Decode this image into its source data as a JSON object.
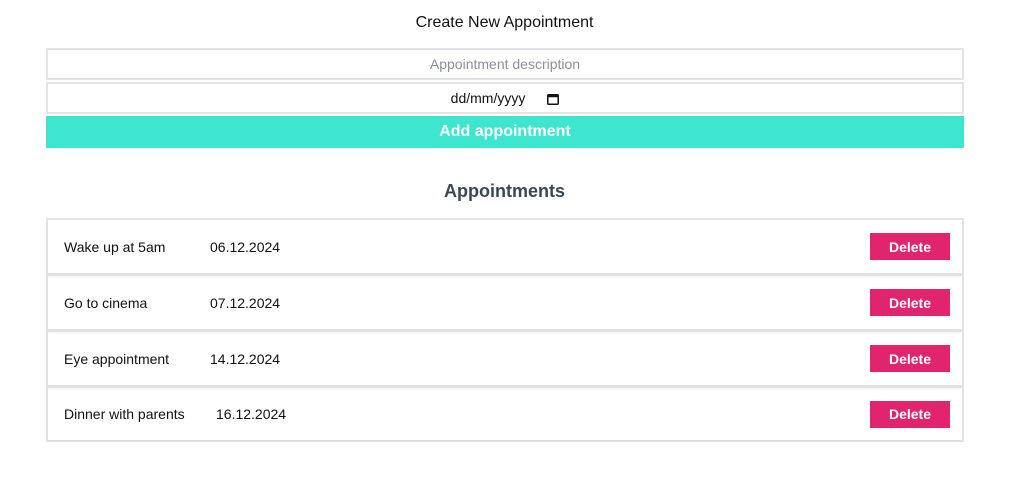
{
  "form": {
    "title": "Create New Appointment",
    "description_placeholder": "Appointment description",
    "date_value": "dd/mm/yyyy",
    "add_button_label": "Add appointment"
  },
  "list": {
    "title": "Appointments",
    "delete_label": "Delete",
    "items": [
      {
        "description": "Wake up at 5am",
        "date": "06.12.2024"
      },
      {
        "description": "Go to cinema",
        "date": "07.12.2024"
      },
      {
        "description": "Eye appointment",
        "date": "14.12.2024"
      },
      {
        "description": "Dinner with parents",
        "date": "16.12.2024"
      }
    ]
  },
  "colors": {
    "accent": "#3ee6cf",
    "delete": "#e0246e",
    "heading": "#3a4659"
  },
  "icons": {
    "date_picker": "calendar-icon"
  }
}
